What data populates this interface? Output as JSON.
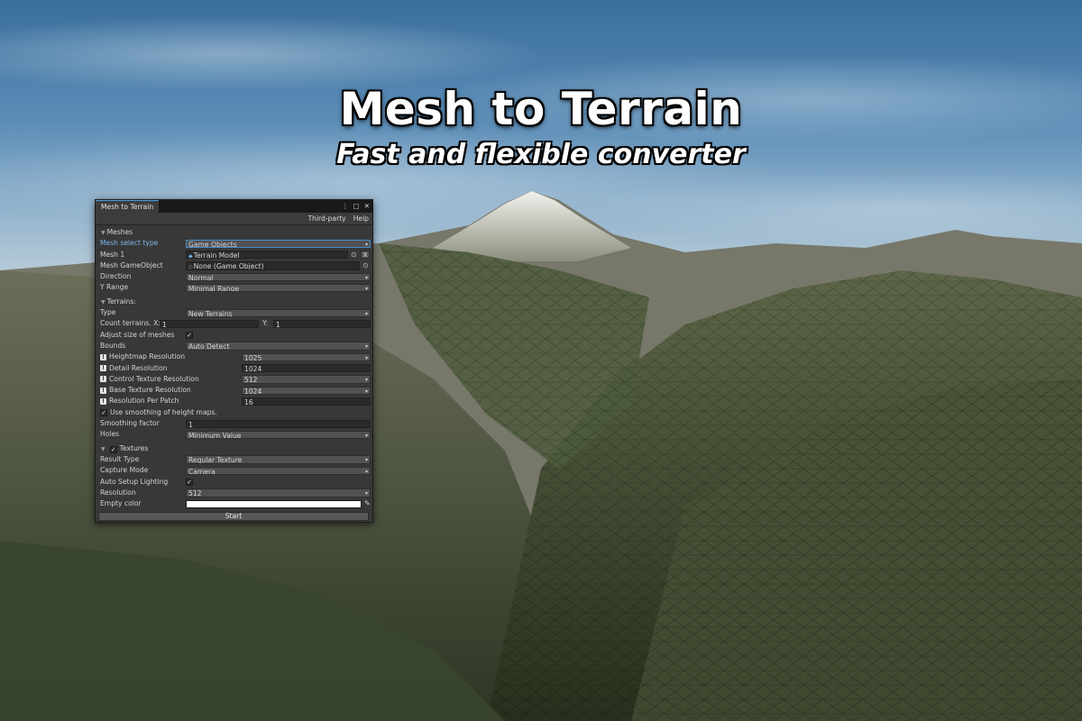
{
  "hero": {
    "title": "Mesh to Terrain",
    "subtitle": "Fast and flexible converter"
  },
  "window": {
    "tab_label": "Mesh to Terrain",
    "menu_icon": "kebab-menu-icon",
    "maximize_icon": "maximize-icon",
    "close_icon": "close-icon",
    "toolbar": {
      "third_party": "Third-party",
      "help": "Help"
    }
  },
  "meshes": {
    "header": "Meshes",
    "mesh_select_type": {
      "label": "Mesh select type",
      "value": "Game Objects"
    },
    "mesh1": {
      "label": "Mesh 1",
      "value": "Terrain Model",
      "remove": "X"
    },
    "mesh_gameobject": {
      "label": "Mesh GameObject",
      "value": "None (Game Object)"
    },
    "direction": {
      "label": "Direction",
      "value": "Normal"
    },
    "y_range": {
      "label": "Y Range",
      "value": "Minimal Range"
    }
  },
  "terrains": {
    "header": "Terrains:",
    "type": {
      "label": "Type",
      "value": "New Terrains"
    },
    "count": {
      "label": "Count terrains. X:",
      "x": "1",
      "y_label": "Y:",
      "y": "1"
    },
    "adjust_size": {
      "label": "Adjust size of meshes",
      "checked": true
    },
    "bounds": {
      "label": "Bounds",
      "value": "Auto Detect"
    },
    "heightmap_res": {
      "label": "Heightmap Resolution",
      "value": "1025"
    },
    "detail_res": {
      "label": "Detail Resolution",
      "value": "1024"
    },
    "control_tex_res": {
      "label": "Control Texture Resolution",
      "value": "512"
    },
    "base_tex_res": {
      "label": "Base Texture Resolution",
      "value": "1024"
    },
    "res_per_patch": {
      "label": "Resolution Per Patch",
      "value": "16"
    },
    "use_smoothing": {
      "label": "Use smoothing of height maps.",
      "checked": true
    },
    "smoothing_factor": {
      "label": "Smoothing factor",
      "value": "1"
    },
    "holes": {
      "label": "Holes",
      "value": "Minimum Value"
    },
    "info_glyph": "!"
  },
  "textures": {
    "header": "Textures",
    "enabled": true,
    "result_type": {
      "label": "Result Type",
      "value": "Regular Texture"
    },
    "capture_mode": {
      "label": "Capture Mode",
      "value": "Camera"
    },
    "auto_lighting": {
      "label": "Auto Setup Lighting",
      "checked": true
    },
    "resolution": {
      "label": "Resolution",
      "value": "512"
    },
    "empty_color": {
      "label": "Empty color",
      "color": "#ffffff"
    }
  },
  "start_label": "Start"
}
